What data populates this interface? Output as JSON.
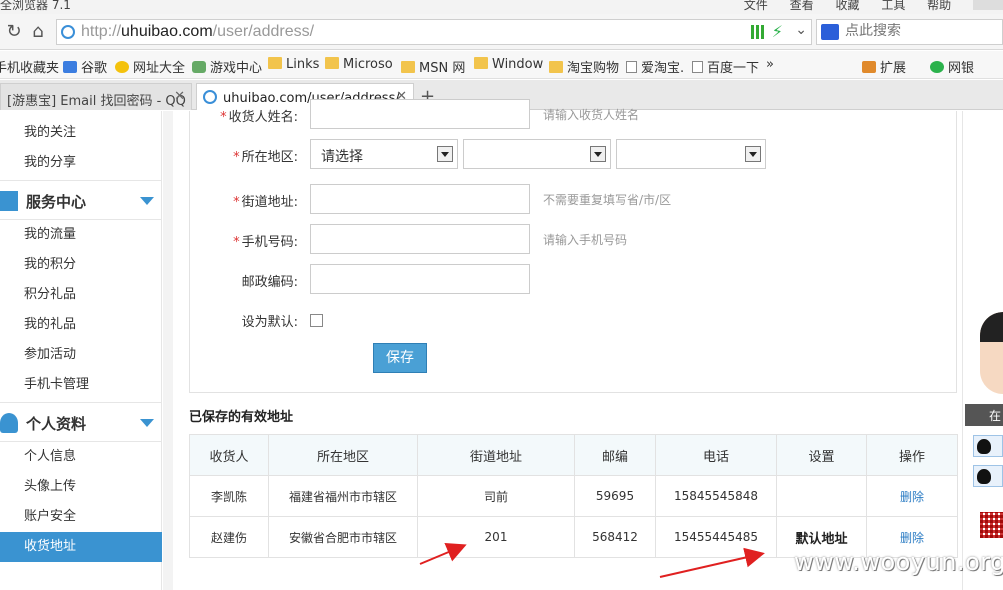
{
  "browser": {
    "title": "全浏览器 7.1",
    "menus": [
      "文件",
      "查看",
      "收藏",
      "工具",
      "帮助"
    ],
    "url_host": "uhuibao.com",
    "url_path": "/user/address/",
    "url_scheme": "http://",
    "search_placeholder": "点此搜索",
    "bookmarks": [
      "手机收藏夹",
      "谷歌",
      "网址大全",
      "游戏中心",
      "Links",
      "Microso",
      "MSN 网",
      "Window",
      "淘宝购物",
      "爱淘宝.",
      "百度一下",
      "»",
      "扩展",
      "网银"
    ],
    "tabs": [
      {
        "label": "[游惠宝] Email 找回密码 - QQ",
        "active": false
      },
      {
        "label": "uhuibao.com/user/address/",
        "active": true
      }
    ],
    "new_tab": "+"
  },
  "sidebar": {
    "items_top": [
      "我的关注",
      "我的分享"
    ],
    "section1": "服务中心",
    "items_mid": [
      "我的流量",
      "我的积分",
      "积分礼品",
      "我的礼品",
      "参加活动",
      "手机卡管理"
    ],
    "section2": "个人资料",
    "items_bottom": [
      "个人信息",
      "头像上传",
      "账户安全",
      "收货地址"
    ],
    "active_item": "收货地址"
  },
  "form": {
    "name_label": "收货人姓名:",
    "name_hint": "请输入收货人姓名",
    "region_label": "所在地区:",
    "region_select": "请选择",
    "street_label": "街道地址:",
    "street_hint": "不需要重复填写省/市/区",
    "phone_label": "手机号码:",
    "phone_hint": "请输入手机号码",
    "zip_label": "邮政编码:",
    "default_label": "设为默认:",
    "save_label": "保存"
  },
  "saved": {
    "title": "已保存的有效地址",
    "columns": [
      "收货人",
      "所在地区",
      "街道地址",
      "邮编",
      "电话",
      "设置",
      "操作"
    ],
    "rows": [
      [
        "李凯陈",
        "福建省福州市市辖区",
        "司前",
        "59695",
        "15845545848",
        "",
        "删除"
      ],
      [
        "赵建伤",
        "安徽省合肥市市辖区",
        "201",
        "568412",
        "15455445485",
        "默认地址",
        "删除"
      ]
    ]
  },
  "widget": {
    "online": "在"
  },
  "watermark": "www.wooyun.org",
  "colors": {
    "accent": "#3a93d1",
    "link": "#2b7cc4",
    "required": "#dd3333",
    "arrow": "#e02020"
  }
}
